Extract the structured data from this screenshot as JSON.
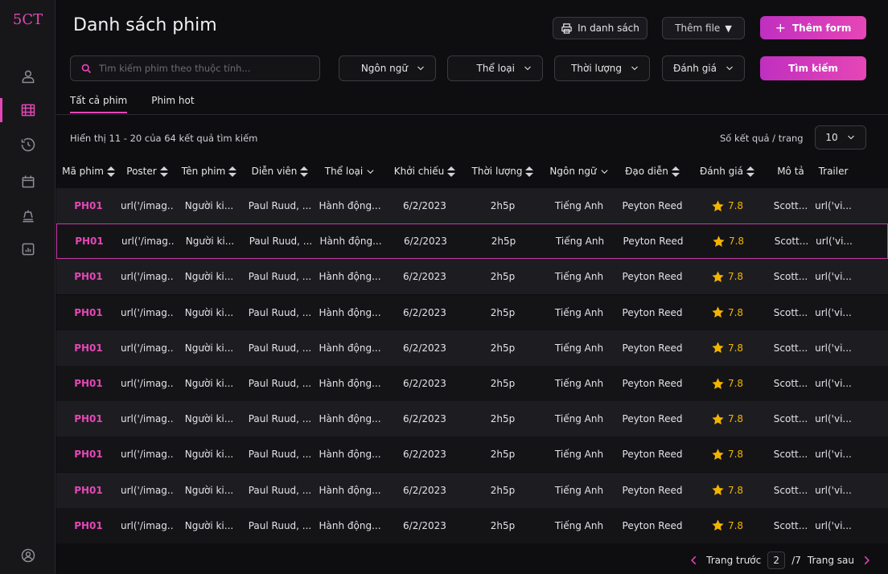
{
  "app": {
    "logo": "5CT"
  },
  "sidebar": {
    "items": [
      {
        "icon": "user-icon"
      },
      {
        "icon": "film-icon",
        "active": true
      },
      {
        "icon": "history-icon"
      },
      {
        "icon": "calendar-icon"
      },
      {
        "icon": "food-icon"
      },
      {
        "icon": "stats-icon"
      }
    ],
    "bottom_icon": "account-icon"
  },
  "header": {
    "title": "Danh sách phim",
    "print_label": "In danh sách",
    "add_file_label": "Thêm file",
    "add_form_label": "Thêm form"
  },
  "search": {
    "placeholder": "Tìm kiếm phim theo thuộc tính...",
    "button_label": "Tìm kiếm"
  },
  "filters": {
    "language": "Ngôn ngữ",
    "genre": "Thể loại",
    "duration": "Thời lượng",
    "rating": "Đánh giá"
  },
  "tabs": [
    {
      "label": "Tất cả phim",
      "active": true
    },
    {
      "label": "Phim hot",
      "active": false
    }
  ],
  "results": {
    "info": "Hiển thị 11 - 20 của 64 kết quả tìm kiếm",
    "per_page_label": "Số kết quả / trang",
    "per_page_value": "10"
  },
  "table": {
    "columns": [
      {
        "label": "Mã phim",
        "control": "sort"
      },
      {
        "label": "Poster",
        "control": "sort"
      },
      {
        "label": "Tên phim",
        "control": "sort"
      },
      {
        "label": "Diễn viên",
        "control": "sort"
      },
      {
        "label": "Thể loại",
        "control": "dropdown"
      },
      {
        "label": "Khởi chiếu",
        "control": "sort"
      },
      {
        "label": "Thời lượng",
        "control": "sort"
      },
      {
        "label": "Ngôn ngữ",
        "control": "dropdown"
      },
      {
        "label": "Đạo diễn",
        "control": "sort"
      },
      {
        "label": "Đánh giá",
        "control": "sort"
      },
      {
        "label": "Mô tả",
        "control": "none"
      },
      {
        "label": "Trailer",
        "control": "none"
      }
    ],
    "rows": [
      {
        "code": "PH01",
        "poster": "url('/imag...",
        "name": "Người ki...",
        "actors": "Paul Ruud, ...",
        "genre": "Hành động...",
        "release": "6/2/2023",
        "duration": "2h5p",
        "language": "Tiếng Anh",
        "director": "Peyton Reed",
        "rating": "7.8",
        "description": "Scott...",
        "trailer": "url('vi..."
      },
      {
        "code": "PH01",
        "poster": "url('/imag...",
        "name": "Người ki...",
        "actors": "Paul Ruud, ...",
        "genre": "Hành động...",
        "release": "6/2/2023",
        "duration": "2h5p",
        "language": "Tiếng Anh",
        "director": "Peyton Reed",
        "rating": "7.8",
        "description": "Scott...",
        "trailer": "url('vi...",
        "selected": true
      },
      {
        "code": "PH01",
        "poster": "url('/imag...",
        "name": "Người ki...",
        "actors": "Paul Ruud, ...",
        "genre": "Hành động...",
        "release": "6/2/2023",
        "duration": "2h5p",
        "language": "Tiếng Anh",
        "director": "Peyton Reed",
        "rating": "7.8",
        "description": "Scott...",
        "trailer": "url('vi..."
      },
      {
        "code": "PH01",
        "poster": "url('/imag...",
        "name": "Người ki...",
        "actors": "Paul Ruud, ...",
        "genre": "Hành động...",
        "release": "6/2/2023",
        "duration": "2h5p",
        "language": "Tiếng Anh",
        "director": "Peyton Reed",
        "rating": "7.8",
        "description": "Scott...",
        "trailer": "url('vi..."
      },
      {
        "code": "PH01",
        "poster": "url('/imag...",
        "name": "Người ki...",
        "actors": "Paul Ruud, ...",
        "genre": "Hành động...",
        "release": "6/2/2023",
        "duration": "2h5p",
        "language": "Tiếng Anh",
        "director": "Peyton Reed",
        "rating": "7.8",
        "description": "Scott...",
        "trailer": "url('vi..."
      },
      {
        "code": "PH01",
        "poster": "url('/imag...",
        "name": "Người ki...",
        "actors": "Paul Ruud, ...",
        "genre": "Hành động...",
        "release": "6/2/2023",
        "duration": "2h5p",
        "language": "Tiếng Anh",
        "director": "Peyton Reed",
        "rating": "7.8",
        "description": "Scott...",
        "trailer": "url('vi..."
      },
      {
        "code": "PH01",
        "poster": "url('/imag...",
        "name": "Người ki...",
        "actors": "Paul Ruud, ...",
        "genre": "Hành động...",
        "release": "6/2/2023",
        "duration": "2h5p",
        "language": "Tiếng Anh",
        "director": "Peyton Reed",
        "rating": "7.8",
        "description": "Scott...",
        "trailer": "url('vi..."
      },
      {
        "code": "PH01",
        "poster": "url('/imag...",
        "name": "Người ki...",
        "actors": "Paul Ruud, ...",
        "genre": "Hành động...",
        "release": "6/2/2023",
        "duration": "2h5p",
        "language": "Tiếng Anh",
        "director": "Peyton Reed",
        "rating": "7.8",
        "description": "Scott...",
        "trailer": "url('vi..."
      },
      {
        "code": "PH01",
        "poster": "url('/imag...",
        "name": "Người ki...",
        "actors": "Paul Ruud, ...",
        "genre": "Hành động...",
        "release": "6/2/2023",
        "duration": "2h5p",
        "language": "Tiếng Anh",
        "director": "Peyton Reed",
        "rating": "7.8",
        "description": "Scott...",
        "trailer": "url('vi..."
      },
      {
        "code": "PH01",
        "poster": "url('/imag...",
        "name": "Người ki...",
        "actors": "Paul Ruud, ...",
        "genre": "Hành động...",
        "release": "6/2/2023",
        "duration": "2h5p",
        "language": "Tiếng Anh",
        "director": "Peyton Reed",
        "rating": "7.8",
        "description": "Scott...",
        "trailer": "url('vi..."
      }
    ]
  },
  "pagination": {
    "prev_label": "Trang trước",
    "current": "2",
    "total": "/7",
    "next_label": "Trang sau"
  },
  "colors": {
    "accent": "#e646b6",
    "star": "#f3b400",
    "background": "#0e0e10"
  }
}
